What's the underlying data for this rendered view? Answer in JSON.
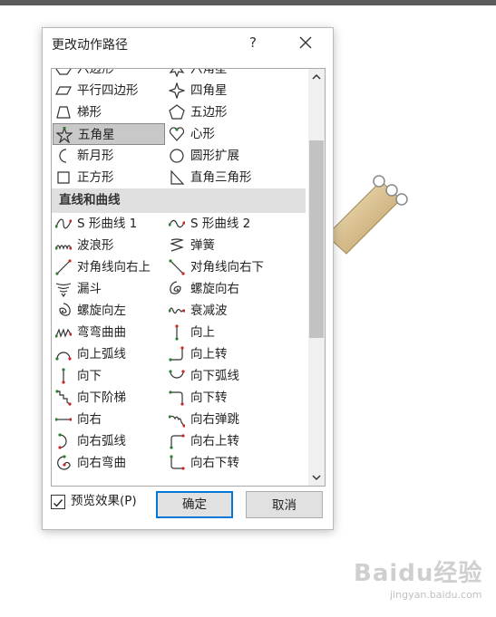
{
  "dialog": {
    "title": "更改动作路径",
    "help_label": "?",
    "close_icon": "close-icon"
  },
  "list": {
    "rows": [
      {
        "type": "pair",
        "items": [
          {
            "label": "六边形",
            "icon": "hexagon-icon"
          },
          {
            "label": "六角星",
            "icon": "six-point-star-icon"
          }
        ]
      },
      {
        "type": "pair",
        "items": [
          {
            "label": "平行四边形",
            "icon": "parallelogram-icon"
          },
          {
            "label": "四角星",
            "icon": "four-point-star-icon"
          }
        ]
      },
      {
        "type": "pair",
        "items": [
          {
            "label": "梯形",
            "icon": "trapezoid-icon"
          },
          {
            "label": "五边形",
            "icon": "pentagon-icon"
          }
        ]
      },
      {
        "type": "pair",
        "items": [
          {
            "label": "五角星",
            "icon": "five-point-star-icon",
            "selected": true
          },
          {
            "label": "心形",
            "icon": "heart-icon"
          }
        ]
      },
      {
        "type": "pair",
        "items": [
          {
            "label": "新月形",
            "icon": "crescent-icon"
          },
          {
            "label": "圆形扩展",
            "icon": "circle-expand-icon"
          }
        ]
      },
      {
        "type": "pair",
        "items": [
          {
            "label": "正方形",
            "icon": "square-icon"
          },
          {
            "label": "直角三角形",
            "icon": "right-triangle-icon"
          }
        ]
      },
      {
        "type": "section",
        "label": "直线和曲线"
      },
      {
        "type": "pair",
        "items": [
          {
            "label": "S 形曲线 1",
            "icon": "s-curve-1-icon"
          },
          {
            "label": "S 形曲线 2",
            "icon": "s-curve-2-icon"
          }
        ]
      },
      {
        "type": "pair",
        "items": [
          {
            "label": "波浪形",
            "icon": "wave-icon"
          },
          {
            "label": "弹簧",
            "icon": "spring-icon"
          }
        ]
      },
      {
        "type": "pair",
        "items": [
          {
            "label": "对角线向右上",
            "icon": "diagonal-up-right-icon"
          },
          {
            "label": "对角线向右下",
            "icon": "diagonal-down-right-icon"
          }
        ]
      },
      {
        "type": "pair",
        "items": [
          {
            "label": "漏斗",
            "icon": "funnel-icon"
          },
          {
            "label": "螺旋向右",
            "icon": "spiral-right-icon"
          }
        ]
      },
      {
        "type": "pair",
        "items": [
          {
            "label": "螺旋向左",
            "icon": "spiral-left-icon"
          },
          {
            "label": "衰减波",
            "icon": "decaying-wave-icon"
          }
        ]
      },
      {
        "type": "pair",
        "items": [
          {
            "label": "弯弯曲曲",
            "icon": "zigzag-icon"
          },
          {
            "label": "向上",
            "icon": "line-up-icon"
          }
        ]
      },
      {
        "type": "pair",
        "items": [
          {
            "label": "向上弧线",
            "icon": "arc-up-icon"
          },
          {
            "label": "向上转",
            "icon": "turn-up-icon"
          }
        ]
      },
      {
        "type": "pair",
        "items": [
          {
            "label": "向下",
            "icon": "line-down-icon"
          },
          {
            "label": "向下弧线",
            "icon": "arc-down-icon"
          }
        ]
      },
      {
        "type": "pair",
        "items": [
          {
            "label": "向下阶梯",
            "icon": "step-down-icon"
          },
          {
            "label": "向下转",
            "icon": "turn-down-icon"
          }
        ]
      },
      {
        "type": "pair",
        "items": [
          {
            "label": "向右",
            "icon": "line-right-icon"
          },
          {
            "label": "向右弹跳",
            "icon": "bounce-right-icon"
          }
        ]
      },
      {
        "type": "pair",
        "items": [
          {
            "label": "向右弧线",
            "icon": "arc-right-icon"
          },
          {
            "label": "向右上转",
            "icon": "turn-up-right-icon"
          }
        ]
      },
      {
        "type": "pair",
        "items": [
          {
            "label": "向右弯曲",
            "icon": "curvy-right-icon"
          },
          {
            "label": "向右下转",
            "icon": "turn-down-right-icon"
          }
        ]
      }
    ]
  },
  "preview": {
    "label": "预览效果(P)",
    "checked": true
  },
  "buttons": {
    "ok": "确定",
    "cancel": "取消"
  },
  "watermark": {
    "logo": "Baidu经验",
    "sub": "jingyan.baidu.com"
  },
  "colors": {
    "accent": "#0078d7",
    "selection": "#c8c8c8",
    "section_bg": "#e0e0e0",
    "icon_green": "#2e7d32",
    "icon_red": "#c62828"
  }
}
